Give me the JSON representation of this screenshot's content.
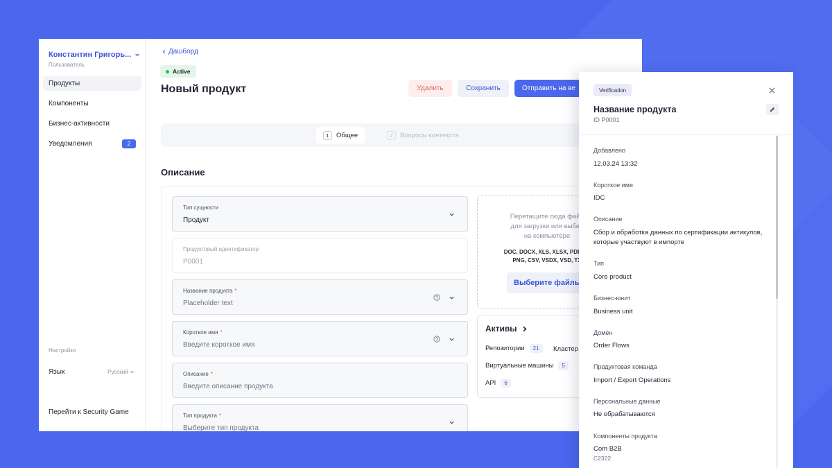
{
  "sidebar": {
    "user_name": "Константин Григорь...",
    "user_role": "Пользователь",
    "items": [
      {
        "label": "Продукты"
      },
      {
        "label": "Компоненты"
      },
      {
        "label": "Бизнес-активности"
      },
      {
        "label": "Уведомления",
        "badge": "2"
      }
    ],
    "settings_title": "Настройки",
    "language_label": "Язык",
    "language_value": "Русский",
    "security_link": "Перейти к Security Game"
  },
  "header": {
    "back_link": "Дашборд",
    "status": "Active",
    "title": "Новый продукт",
    "delete_label": "Удалить",
    "save_label": "Сохранить",
    "send_label": "Отправить на ве"
  },
  "steps": [
    {
      "num": "1",
      "label": "Общее"
    },
    {
      "num": "2",
      "label": "Вопросы контекста"
    }
  ],
  "form": {
    "section_title": "Описание",
    "fields": [
      {
        "label": "Тип сущности",
        "value": "Продукт"
      },
      {
        "label": "Продуктовый идентификатор",
        "value": "P0001"
      },
      {
        "label": "Название продукта",
        "value": "Placeholder text"
      },
      {
        "label": "Короткое имя",
        "value": "Введите короткое имя"
      },
      {
        "label": "Описание",
        "value": "Введите описание продукта"
      },
      {
        "label": "Тип продукта",
        "value": "Выберите тип продукта"
      }
    ],
    "required_mark": "*"
  },
  "dropzone": {
    "line1": "Перетащите сюда файл",
    "line2": "для загрузки или выбер",
    "line3": "на компьютере",
    "formats1": "DOC, DOCX, XLS, XLSX, PDF, JP",
    "formats2": "PNG, CSV, VSDX, VSD, TX",
    "button": "Выберите файлы"
  },
  "assets": {
    "title": "Активы",
    "items": [
      {
        "label": "Репозитории",
        "count": "21"
      },
      {
        "label": "Кластер",
        "count": ""
      },
      {
        "label": "Виртуальные машины",
        "count": "5"
      },
      {
        "label": "API",
        "count": "6"
      }
    ]
  },
  "panel": {
    "badge": "Verification",
    "title": "Название продукта",
    "id": "ID P0001",
    "rows": [
      {
        "label": "Добавлено",
        "value": "12.03.24 13:32"
      },
      {
        "label": "Короткое имя",
        "value": "IDC"
      },
      {
        "label": "Описание",
        "value": "Сбор и обработка данных по сертификации актикулов, которые участвуют в импорте"
      },
      {
        "label": "Тип",
        "value": "Core product"
      },
      {
        "label": "Бизнес-юнит",
        "value": "Business unit"
      },
      {
        "label": "Домен",
        "value": "Order Flows"
      },
      {
        "label": "Продуктовая команда",
        "value": "Import / Export Operations"
      },
      {
        "label": "Персональные данные",
        "value": "Не обрабатываются"
      },
      {
        "label": "Компоненты продукта",
        "value": "Com B2B",
        "sub": "C2322"
      }
    ]
  },
  "colors": {
    "background": "#4a67ee",
    "accent": "#4a67ee",
    "link": "#3d55d6",
    "danger": "#e06868",
    "success": "#2fb660"
  }
}
